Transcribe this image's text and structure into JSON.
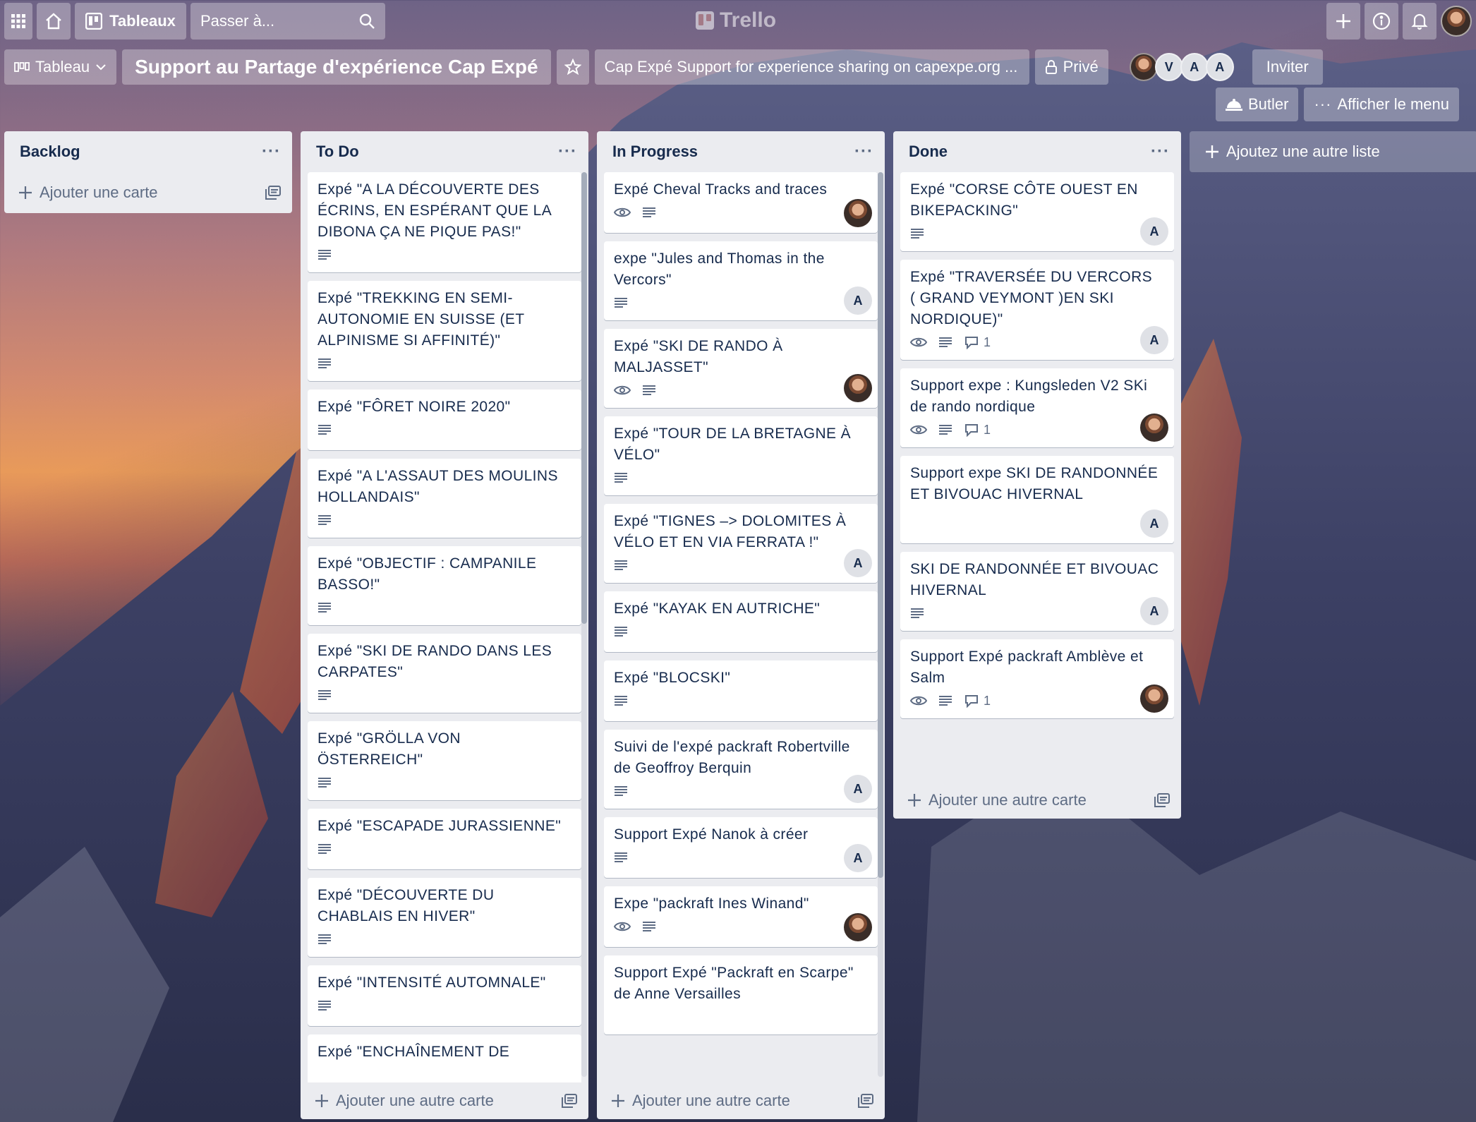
{
  "topbar": {
    "boards_label": "Tableaux",
    "search_placeholder": "Passer à...",
    "logo": "Trello"
  },
  "board": {
    "view_label": "Tableau",
    "title": "Support au Partage d'expérience Cap Expé",
    "description": "Cap Expé Support for experience sharing on capexpe.org ...",
    "visibility": "Privé",
    "members": [
      "V",
      "A",
      "A"
    ],
    "invite_label": "Inviter",
    "butler_label": "Butler",
    "menu_label": "Afficher le menu"
  },
  "lists": [
    {
      "name": "Backlog",
      "add_label": "Ajouter une carte",
      "cards": []
    },
    {
      "name": "To Do",
      "add_label": "Ajouter une autre carte",
      "cards": [
        {
          "title": "Expé \"A LA DÉCOUVERTE DES ÉCRINS, EN ESPÉRANT QUE LA DIBONA ÇA NE PIQUE PAS!\"",
          "watch": false,
          "desc": true,
          "comments": "",
          "member": ""
        },
        {
          "title": "Expé \"TREKKING EN SEMI-AUTONOMIE EN SUISSE (ET ALPINISME SI AFFINITÉ)\"",
          "watch": false,
          "desc": true,
          "comments": "",
          "member": ""
        },
        {
          "title": "Expé \"FÔRET NOIRE 2020\"",
          "watch": false,
          "desc": true,
          "comments": "",
          "member": ""
        },
        {
          "title": "Expé \"A L'ASSAUT DES MOULINS HOLLANDAIS\"",
          "watch": false,
          "desc": true,
          "comments": "",
          "member": ""
        },
        {
          "title": "Expé \"OBJECTIF : CAMPANILE BASSO!\"",
          "watch": false,
          "desc": true,
          "comments": "",
          "member": ""
        },
        {
          "title": "Expé \"SKI DE RANDO DANS LES CARPATES\"",
          "watch": false,
          "desc": true,
          "comments": "",
          "member": ""
        },
        {
          "title": "Expé \"GRÖLLA VON ÖSTERREICH\"",
          "watch": false,
          "desc": true,
          "comments": "",
          "member": ""
        },
        {
          "title": "Expé \"ESCAPADE JURASSIENNE\"",
          "watch": false,
          "desc": true,
          "comments": "",
          "member": ""
        },
        {
          "title": "Expé \"DÉCOUVERTE DU CHABLAIS EN HIVER\"",
          "watch": false,
          "desc": true,
          "comments": "",
          "member": ""
        },
        {
          "title": "Expé \"INTENSITÉ AUTOMNALE\"",
          "watch": false,
          "desc": true,
          "comments": "",
          "member": ""
        },
        {
          "title": "Expé \"ENCHAÎNEMENT DE",
          "watch": false,
          "desc": false,
          "comments": "",
          "member": ""
        }
      ]
    },
    {
      "name": "In Progress",
      "add_label": "Ajouter une autre carte",
      "cards": [
        {
          "title": "Expé Cheval Tracks and traces",
          "watch": true,
          "desc": true,
          "comments": "",
          "member": "photo"
        },
        {
          "title": "expe \"Jules and Thomas in the Vercors\"",
          "watch": false,
          "desc": true,
          "comments": "",
          "member": "A"
        },
        {
          "title": "Expé \"SKI DE RANDO À MALJASSET\"",
          "watch": true,
          "desc": true,
          "comments": "",
          "member": "photo"
        },
        {
          "title": "Expé \"TOUR DE LA BRETAGNE À VÉLO\"",
          "watch": false,
          "desc": true,
          "comments": "",
          "member": ""
        },
        {
          "title": "Expé \"TIGNES –> DOLOMITES À VÉLO ET EN VIA FERRATA !\"",
          "watch": false,
          "desc": true,
          "comments": "",
          "member": "A"
        },
        {
          "title": "Expé \"KAYAK EN AUTRICHE\"",
          "watch": false,
          "desc": true,
          "comments": "",
          "member": ""
        },
        {
          "title": "Expé \"BLOCSKI\"",
          "watch": false,
          "desc": true,
          "comments": "",
          "member": ""
        },
        {
          "title": "Suivi de l'expé packraft Robertville de Geoffroy Berquin",
          "watch": false,
          "desc": true,
          "comments": "",
          "member": "A"
        },
        {
          "title": "Support Expé Nanok à créer",
          "watch": false,
          "desc": true,
          "comments": "",
          "member": "A"
        },
        {
          "title": "Expe \"packraft Ines Winand\"",
          "watch": true,
          "desc": true,
          "comments": "",
          "member": "photo"
        },
        {
          "title": "Support Expé \"Packraft en Scarpe\" de Anne Versailles",
          "watch": false,
          "desc": false,
          "comments": "",
          "member": ""
        }
      ]
    },
    {
      "name": "Done",
      "add_label": "Ajouter une autre carte",
      "cards": [
        {
          "title": "Expé \"CORSE CÔTE OUEST EN BIKEPACKING\"",
          "watch": false,
          "desc": true,
          "comments": "",
          "member": "A"
        },
        {
          "title": "Expé \"TRAVERSÉE DU VERCORS ( GRAND VEYMONT )EN SKI NORDIQUE)\"",
          "watch": true,
          "desc": true,
          "comments": "1",
          "member": "A"
        },
        {
          "title": "Support expe : Kungsleden V2 SKi de rando nordique",
          "watch": true,
          "desc": true,
          "comments": "1",
          "member": "photo"
        },
        {
          "title": "Support expe SKI DE RANDONNÉE ET BIVOUAC HIVERNAL",
          "watch": false,
          "desc": false,
          "comments": "",
          "member": "A"
        },
        {
          "title": "SKI DE RANDONNÉE ET BIVOUAC HIVERNAL",
          "watch": false,
          "desc": true,
          "comments": "",
          "member": "A"
        },
        {
          "title": "Support Expé packraft Amblève et Salm",
          "watch": true,
          "desc": true,
          "comments": "1",
          "member": "photo"
        }
      ]
    }
  ],
  "add_list_label": "Ajoutez une autre liste",
  "colors": {
    "list_bg": "#ebecf0",
    "card_bg": "#ffffff",
    "text": "#172b4d",
    "muted": "#5e6c84"
  }
}
